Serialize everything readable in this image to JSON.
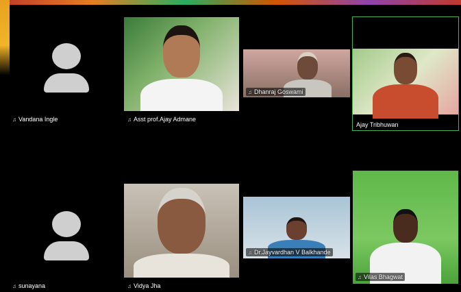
{
  "participants": [
    {
      "name": "Vandana Ingle",
      "video": false
    },
    {
      "name": "Asst prof.Ajay Admane",
      "video": true
    },
    {
      "name": "Dhanraj Goswami",
      "video": true
    },
    {
      "name": "Ajay Tribhuwan",
      "video": true,
      "active_speaker": true
    },
    {
      "name": "sunayana",
      "video": false
    },
    {
      "name": "Vidya Jha",
      "video": true
    },
    {
      "name": "Dr.Jayvardhan V Balkhande",
      "video": true
    },
    {
      "name": "Vilas Bhagwat",
      "video": true
    }
  ],
  "icons": {
    "muted": "mic-off-icon",
    "no_video": "avatar-placeholder-icon"
  },
  "colors": {
    "background": "#000000",
    "active_border": "#4caf50",
    "avatar": "#cfcfcf"
  }
}
